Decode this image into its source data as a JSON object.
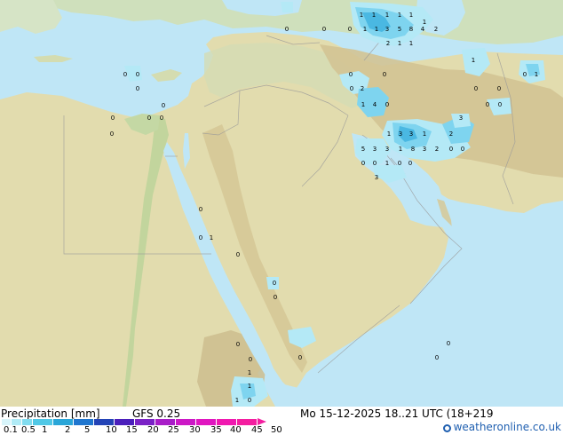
{
  "footer": {
    "title": "Precipitation [mm]",
    "model": "GFS 0.25",
    "datetime": "Mo 15-12-2025 18..21 UTC (18+219",
    "credit": "weatheronline.co.uk"
  },
  "legend": {
    "labels": [
      "0.1",
      "0.5",
      "1",
      "2",
      "5",
      "10",
      "15",
      "20",
      "25",
      "30",
      "35",
      "40",
      "45",
      "50"
    ],
    "colors": [
      "#d8f5fb",
      "#b0ebf6",
      "#80dcef",
      "#50c8e6",
      "#2aa6d8",
      "#1f76cf",
      "#2343b6",
      "#4b1fbb",
      "#7a22c6",
      "#a81dc8",
      "#cc18c6",
      "#e016c0",
      "#f019b0",
      "#f41ea0"
    ]
  },
  "colors": {
    "sea": "#bfe6f6",
    "land": "#e2dcae",
    "highland": "#d0bf8e",
    "vegetation": "#c9ddb1",
    "precip_light": "#b4e9f6",
    "precip_medium": "#7ed4ef",
    "precip_heavy": "#4ab8e2"
  },
  "map_values": [
    {
      "t": "1"
    },
    {
      "t": "1"
    },
    {
      "t": "1"
    },
    {
      "t": "1"
    },
    {
      "t": "1"
    },
    {
      "t": "1"
    },
    {
      "t": "0"
    },
    {
      "t": "1"
    },
    {
      "t": "1"
    },
    {
      "t": "3"
    },
    {
      "t": "5"
    },
    {
      "t": "8"
    },
    {
      "t": "4"
    },
    {
      "t": "2"
    },
    {
      "t": "0"
    },
    {
      "t": "2"
    },
    {
      "t": "1"
    },
    {
      "t": "1"
    },
    {
      "t": "0"
    },
    {
      "t": "0"
    },
    {
      "t": "0"
    },
    {
      "t": "0"
    },
    {
      "t": "0"
    },
    {
      "t": "0"
    },
    {
      "t": "0"
    },
    {
      "t": "0"
    },
    {
      "t": "0"
    },
    {
      "t": "0"
    },
    {
      "t": "0"
    },
    {
      "t": "2"
    },
    {
      "t": "1"
    },
    {
      "t": "4"
    },
    {
      "t": "0"
    },
    {
      "t": "0"
    },
    {
      "t": "1"
    },
    {
      "t": "0"
    },
    {
      "t": "0"
    },
    {
      "t": "0"
    },
    {
      "t": "1"
    },
    {
      "t": "0"
    },
    {
      "t": "0"
    },
    {
      "t": "3"
    },
    {
      "t": "1"
    },
    {
      "t": "3"
    },
    {
      "t": "3"
    },
    {
      "t": "1"
    },
    {
      "t": "2"
    },
    {
      "t": "5"
    },
    {
      "t": "3"
    },
    {
      "t": "3"
    },
    {
      "t": "1"
    },
    {
      "t": "8"
    },
    {
      "t": "3"
    },
    {
      "t": "2"
    },
    {
      "t": "0"
    },
    {
      "t": "0"
    },
    {
      "t": "0"
    },
    {
      "t": "0"
    },
    {
      "t": "1"
    },
    {
      "t": "3"
    },
    {
      "t": "0"
    },
    {
      "t": "0"
    },
    {
      "t": "0"
    },
    {
      "t": "0"
    },
    {
      "t": "1"
    },
    {
      "t": "0"
    },
    {
      "t": "0"
    },
    {
      "t": "0"
    },
    {
      "t": "0"
    },
    {
      "t": "0"
    },
    {
      "t": "0"
    },
    {
      "t": "0"
    },
    {
      "t": "0"
    },
    {
      "t": "1"
    },
    {
      "t": "1"
    },
    {
      "t": "1"
    },
    {
      "t": "0"
    }
  ]
}
